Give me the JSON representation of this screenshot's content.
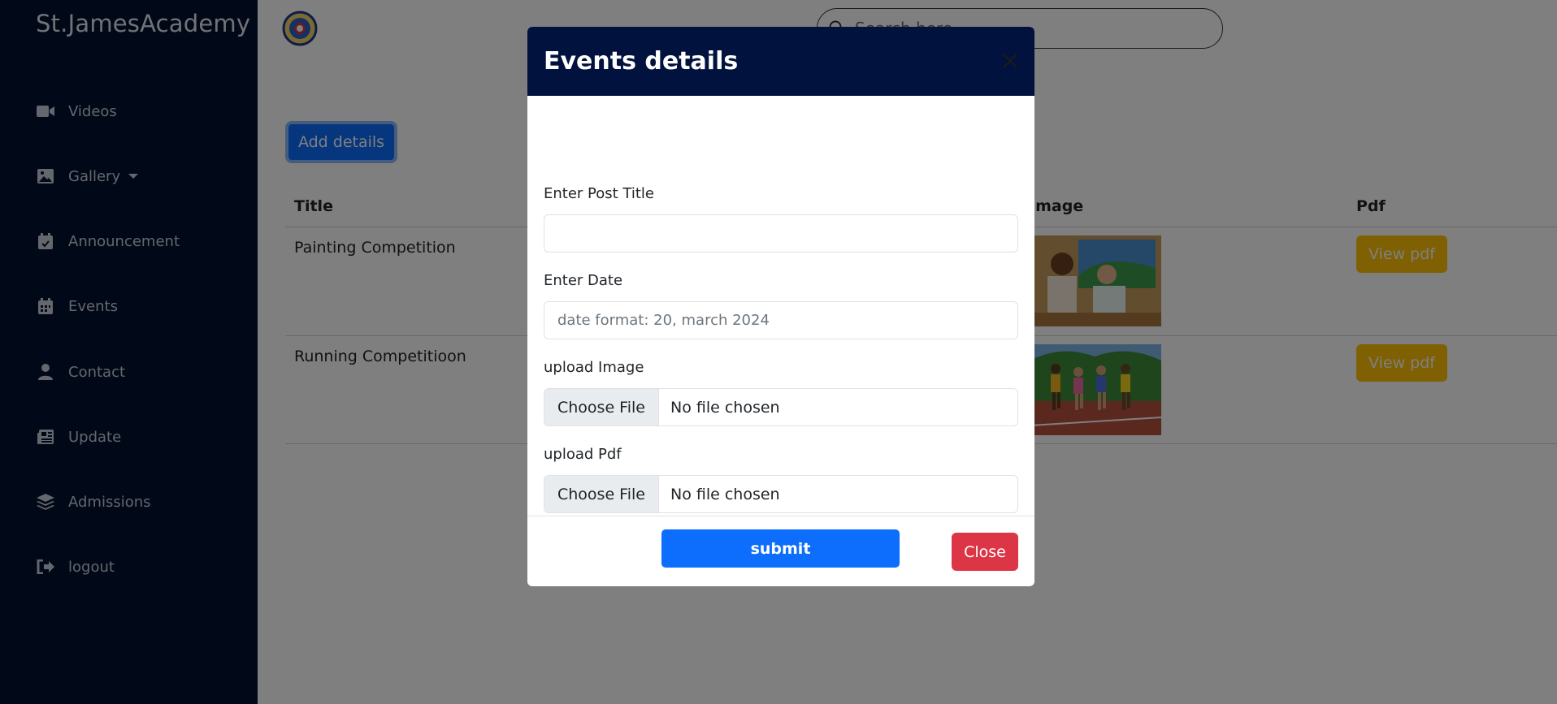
{
  "sidebar": {
    "brand": "St.JamesAcademy",
    "items": [
      {
        "label": "Videos",
        "icon": "video-icon"
      },
      {
        "label": "Gallery",
        "icon": "image-icon"
      },
      {
        "label": "Announcement",
        "icon": "calendar-check-icon"
      },
      {
        "label": "Events",
        "icon": "calendar-icon"
      },
      {
        "label": "Contact",
        "icon": "user-icon"
      },
      {
        "label": "Update",
        "icon": "newspaper-icon"
      },
      {
        "label": "Admissions",
        "icon": "layers-icon"
      },
      {
        "label": "logout",
        "icon": "logout-icon"
      }
    ]
  },
  "header": {
    "search_placeholder": "Search here"
  },
  "main": {
    "add_button": "Add details",
    "columns": [
      "Title",
      "Image",
      "Pdf"
    ],
    "rows": [
      {
        "title": "Painting Competition",
        "pdf_label": "View pdf"
      },
      {
        "title": "Running Competitioon",
        "pdf_label": "View pdf"
      }
    ]
  },
  "modal": {
    "title": "Events details",
    "post_title_label": "Enter Post Title",
    "post_title_value": "",
    "date_label": "Enter Date",
    "date_placeholder": "date format: 20, march 2024",
    "image_label": "upload Image",
    "pdf_label": "upload Pdf",
    "choose_file": "Choose File",
    "no_file": "No file chosen",
    "submit": "submit",
    "close": "Close"
  },
  "colors": {
    "sidebar_bg": "#02102e",
    "modal_header_bg": "#02123f",
    "primary": "#0d6efd",
    "warning": "#ffc107",
    "danger": "#dc3545"
  }
}
